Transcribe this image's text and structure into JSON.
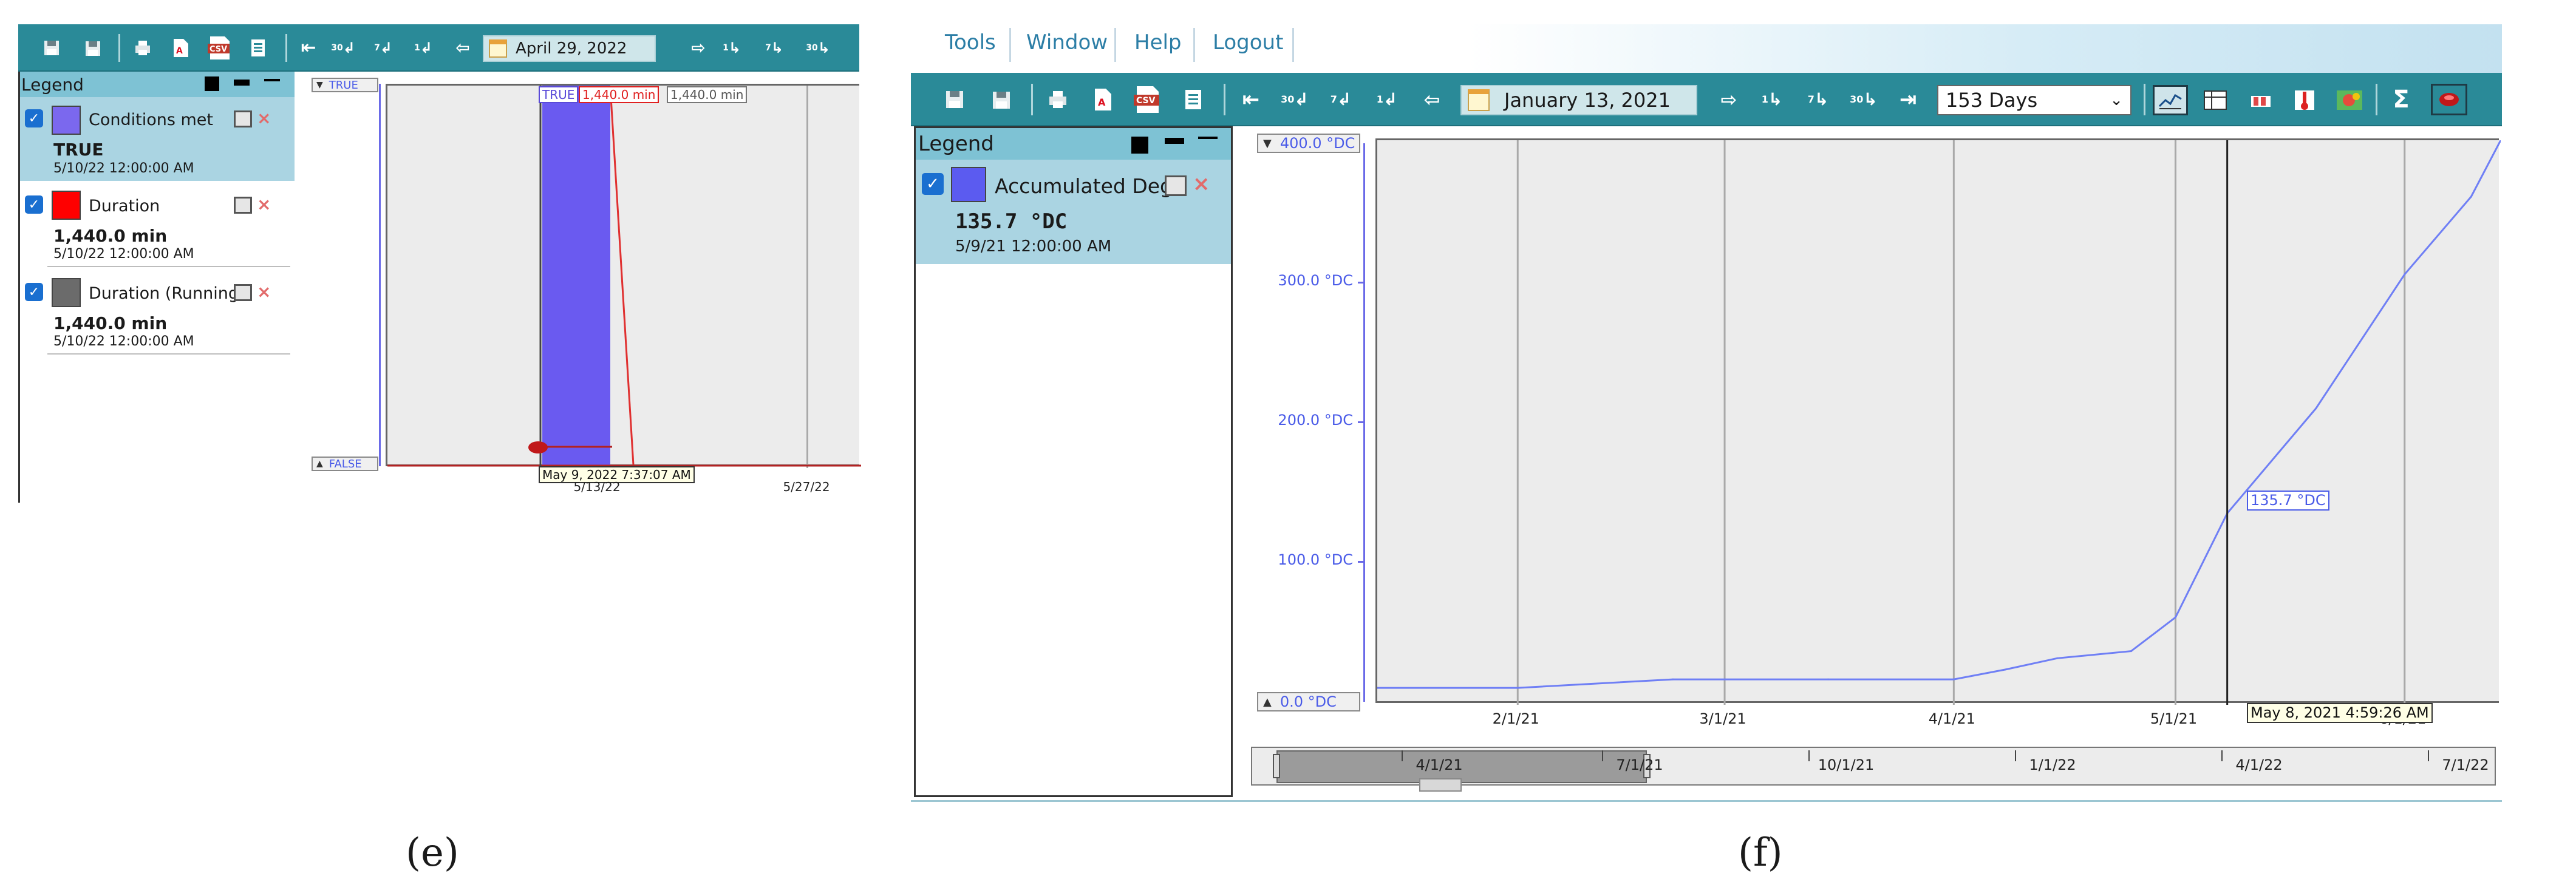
{
  "panel_e": {
    "caption": "(e)",
    "toolbar": {
      "date": "April 29, 2022",
      "buttons": {
        "save": "save-icon",
        "save_as": "save-as-icon",
        "print": "printer-icon",
        "pdf": "PDF",
        "csv": "csv",
        "report": "report-icon",
        "first": "⇤",
        "back30": "30",
        "back7": "7",
        "back1": "1",
        "prev": "⇦",
        "next": "⇨",
        "fwd1": "1",
        "fwd7": "7",
        "fwd30": "30"
      }
    },
    "legend": {
      "title": "Legend",
      "items": [
        {
          "name": "Conditions met",
          "value": "TRUE",
          "time": "5/10/22 12:00:00 AM",
          "color": "#7b68ee",
          "selected": true
        },
        {
          "name": "Duration",
          "value": "1,440.0 min",
          "time": "5/10/22 12:00:00 AM",
          "color": "#ff0000",
          "selected": false
        },
        {
          "name": "Duration (Running",
          "value": "1,440.0 min",
          "time": "5/10/22 12:00:00 AM",
          "color": "#6b6b6b",
          "selected": false
        }
      ]
    },
    "chart": {
      "y_top": "TRUE",
      "y_bottom": "FALSE",
      "tags": {
        "true": "TRUE",
        "duration": "1,440.0 min",
        "running": "1,440.0 min"
      },
      "cursor_time": "May 9, 2022 7:37:07 AM",
      "x_ticks": [
        "5/13/22",
        "5/27/22"
      ]
    }
  },
  "panel_f": {
    "caption": "(f)",
    "menu": [
      "Tools",
      "Window",
      "Help",
      "Logout"
    ],
    "toolbar": {
      "date": "January 13, 2021",
      "range": "153 Days",
      "buttons": {
        "save": "save-icon",
        "save_as": "save-as-icon",
        "print": "printer-icon",
        "pdf": "PDF",
        "csv": "csv",
        "report": "report-icon",
        "first": "⇤",
        "back30": "30",
        "back7": "7",
        "back1": "1",
        "prev": "⇦",
        "next": "⇨",
        "fwd1": "1",
        "fwd7": "7",
        "fwd30": "30",
        "last": "⇥",
        "line_chart": "line-chart-icon",
        "table": "table-icon",
        "bars": "bar-icon",
        "thermo": "thermometer-icon",
        "map": "map-icon",
        "sum": "Σ",
        "pin": "pin-icon"
      }
    },
    "legend": {
      "title": "Legend",
      "items": [
        {
          "name": "Accumulated Degr",
          "value": "135.7 °DC",
          "time": "5/9/21 12:00:00 AM",
          "color": "#5b5bf0",
          "selected": true
        }
      ]
    },
    "chart": {
      "y_ticks": [
        "400.0 °DC",
        "300.0 °DC",
        "200.0 °DC",
        "100.0 °DC",
        "0.0 °DC"
      ],
      "x_ticks": [
        "2/1/21",
        "3/1/21",
        "4/1/21",
        "5/1/21",
        "6/1/21"
      ],
      "cursor_value": "135.7 °DC",
      "cursor_time": "May 8, 2021 4:59:26 AM",
      "nav_ticks": [
        "4/1/21",
        "7/1/21",
        "10/1/21",
        "1/1/22",
        "4/1/22",
        "7/1/22"
      ],
      "line_color": "#6f7ff5"
    }
  },
  "chart_data": {
    "type": "line",
    "title": "",
    "xlabel": "",
    "ylabel": "",
    "ylim": [
      0,
      400
    ],
    "x": [
      "2021-01-13",
      "2021-02-01",
      "2021-02-22",
      "2021-03-15",
      "2021-04-01",
      "2021-04-08",
      "2021-04-15",
      "2021-04-25",
      "2021-05-01",
      "2021-05-08",
      "2021-05-20",
      "2021-06-01",
      "2021-06-10",
      "2021-06-14"
    ],
    "series": [
      {
        "values": [
          12,
          12,
          18,
          18,
          18,
          25,
          33,
          38,
          62,
          135.7,
          210,
          305,
          360,
          400
        ]
      }
    ]
  }
}
